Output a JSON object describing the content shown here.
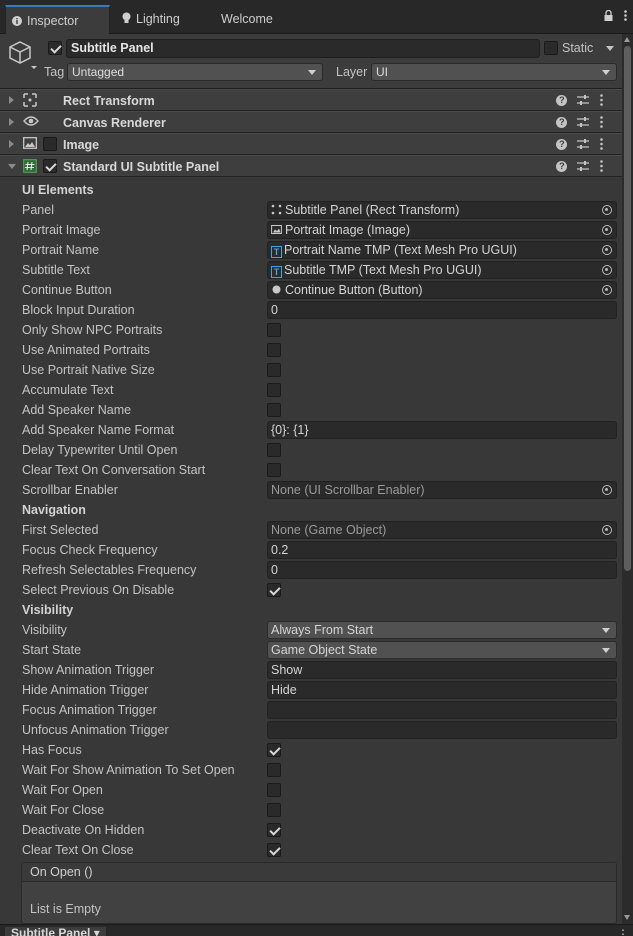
{
  "tabs": [
    {
      "label": "Inspector",
      "icon": "info-icon"
    },
    {
      "label": "Lighting",
      "icon": "lightbulb-icon"
    },
    {
      "label": "Welcome"
    }
  ],
  "header": {
    "object_name": "Subtitle Panel",
    "active": true,
    "static_label": "Static",
    "static": false,
    "tag_label": "Tag",
    "tag_value": "Untagged",
    "layer_label": "Layer",
    "layer_value": "UI"
  },
  "components": [
    {
      "title": "Rect Transform",
      "icon": "rect-transform-icon",
      "expanded": false
    },
    {
      "title": "Canvas Renderer",
      "icon": "eye-icon",
      "expanded": false
    },
    {
      "title": "Image",
      "icon": "image-icon",
      "expanded": false,
      "enabled": false
    },
    {
      "title": "Standard UI Subtitle Panel",
      "icon": "script-icon",
      "expanded": true,
      "enabled": true
    }
  ],
  "properties": [
    {
      "label": "UI Elements",
      "type": "section"
    },
    {
      "label": "Panel",
      "type": "object",
      "value": "Subtitle Panel (Rect Transform)",
      "icon": "rect-transform-icon"
    },
    {
      "label": "Portrait Image",
      "type": "object",
      "value": "Portrait Image (Image)",
      "icon": "image-icon"
    },
    {
      "label": "Portrait Name",
      "type": "object",
      "value": "Portrait Name TMP (Text Mesh Pro UGUI)",
      "icon": "tmp-icon"
    },
    {
      "label": "Subtitle Text",
      "type": "object",
      "value": "Subtitle TMP (Text Mesh Pro UGUI)",
      "icon": "tmp-icon"
    },
    {
      "label": "Continue Button",
      "type": "object",
      "value": "Continue Button (Button)",
      "icon": "button-icon"
    },
    {
      "label": "Block Input Duration",
      "type": "text",
      "value": "0"
    },
    {
      "label": "Only Show NPC Portraits",
      "type": "check",
      "value": false
    },
    {
      "label": "Use Animated Portraits",
      "type": "check",
      "value": false
    },
    {
      "label": "Use Portrait Native Size",
      "type": "check",
      "value": false
    },
    {
      "label": "Accumulate Text",
      "type": "check",
      "value": false
    },
    {
      "label": "Add Speaker Name",
      "type": "check",
      "value": false
    },
    {
      "label": "Add Speaker Name Format",
      "type": "text",
      "value": "{0}: {1}"
    },
    {
      "label": "Delay Typewriter Until Open",
      "type": "check",
      "value": false
    },
    {
      "label": "Clear Text On Conversation Start",
      "type": "check",
      "value": false
    },
    {
      "label": "Scrollbar Enabler",
      "type": "object-none",
      "value": "None (UI Scrollbar Enabler)"
    },
    {
      "label": "Navigation",
      "type": "section"
    },
    {
      "label": "First Selected",
      "type": "object-none",
      "value": "None (Game Object)"
    },
    {
      "label": "Focus Check Frequency",
      "type": "text",
      "value": "0.2"
    },
    {
      "label": "Refresh Selectables Frequency",
      "type": "text",
      "value": "0"
    },
    {
      "label": "Select Previous On Disable",
      "type": "check",
      "value": true
    },
    {
      "label": "Visibility",
      "type": "section"
    },
    {
      "label": "Visibility",
      "type": "dropdown",
      "value": "Always From Start"
    },
    {
      "label": "Start State",
      "type": "dropdown",
      "value": "Game Object State"
    },
    {
      "label": "Show Animation Trigger",
      "type": "text",
      "value": "Show"
    },
    {
      "label": "Hide Animation Trigger",
      "type": "text",
      "value": "Hide"
    },
    {
      "label": "Focus Animation Trigger",
      "type": "text",
      "value": ""
    },
    {
      "label": "Unfocus Animation Trigger",
      "type": "text",
      "value": ""
    },
    {
      "label": "Has Focus",
      "type": "check",
      "value": true
    },
    {
      "label": "Wait For Show Animation To Set Open",
      "type": "check",
      "value": false
    },
    {
      "label": "Wait For Open",
      "type": "check",
      "value": false
    },
    {
      "label": "Wait For Close",
      "type": "check",
      "value": false
    },
    {
      "label": "Deactivate On Hidden",
      "type": "check",
      "value": true
    },
    {
      "label": "Clear Text On Close",
      "type": "check",
      "value": true
    }
  ],
  "event": {
    "title": "On Open ()",
    "empty_label": "List is Empty"
  },
  "bottom": {
    "tab_label": "Subtitle Panel"
  }
}
